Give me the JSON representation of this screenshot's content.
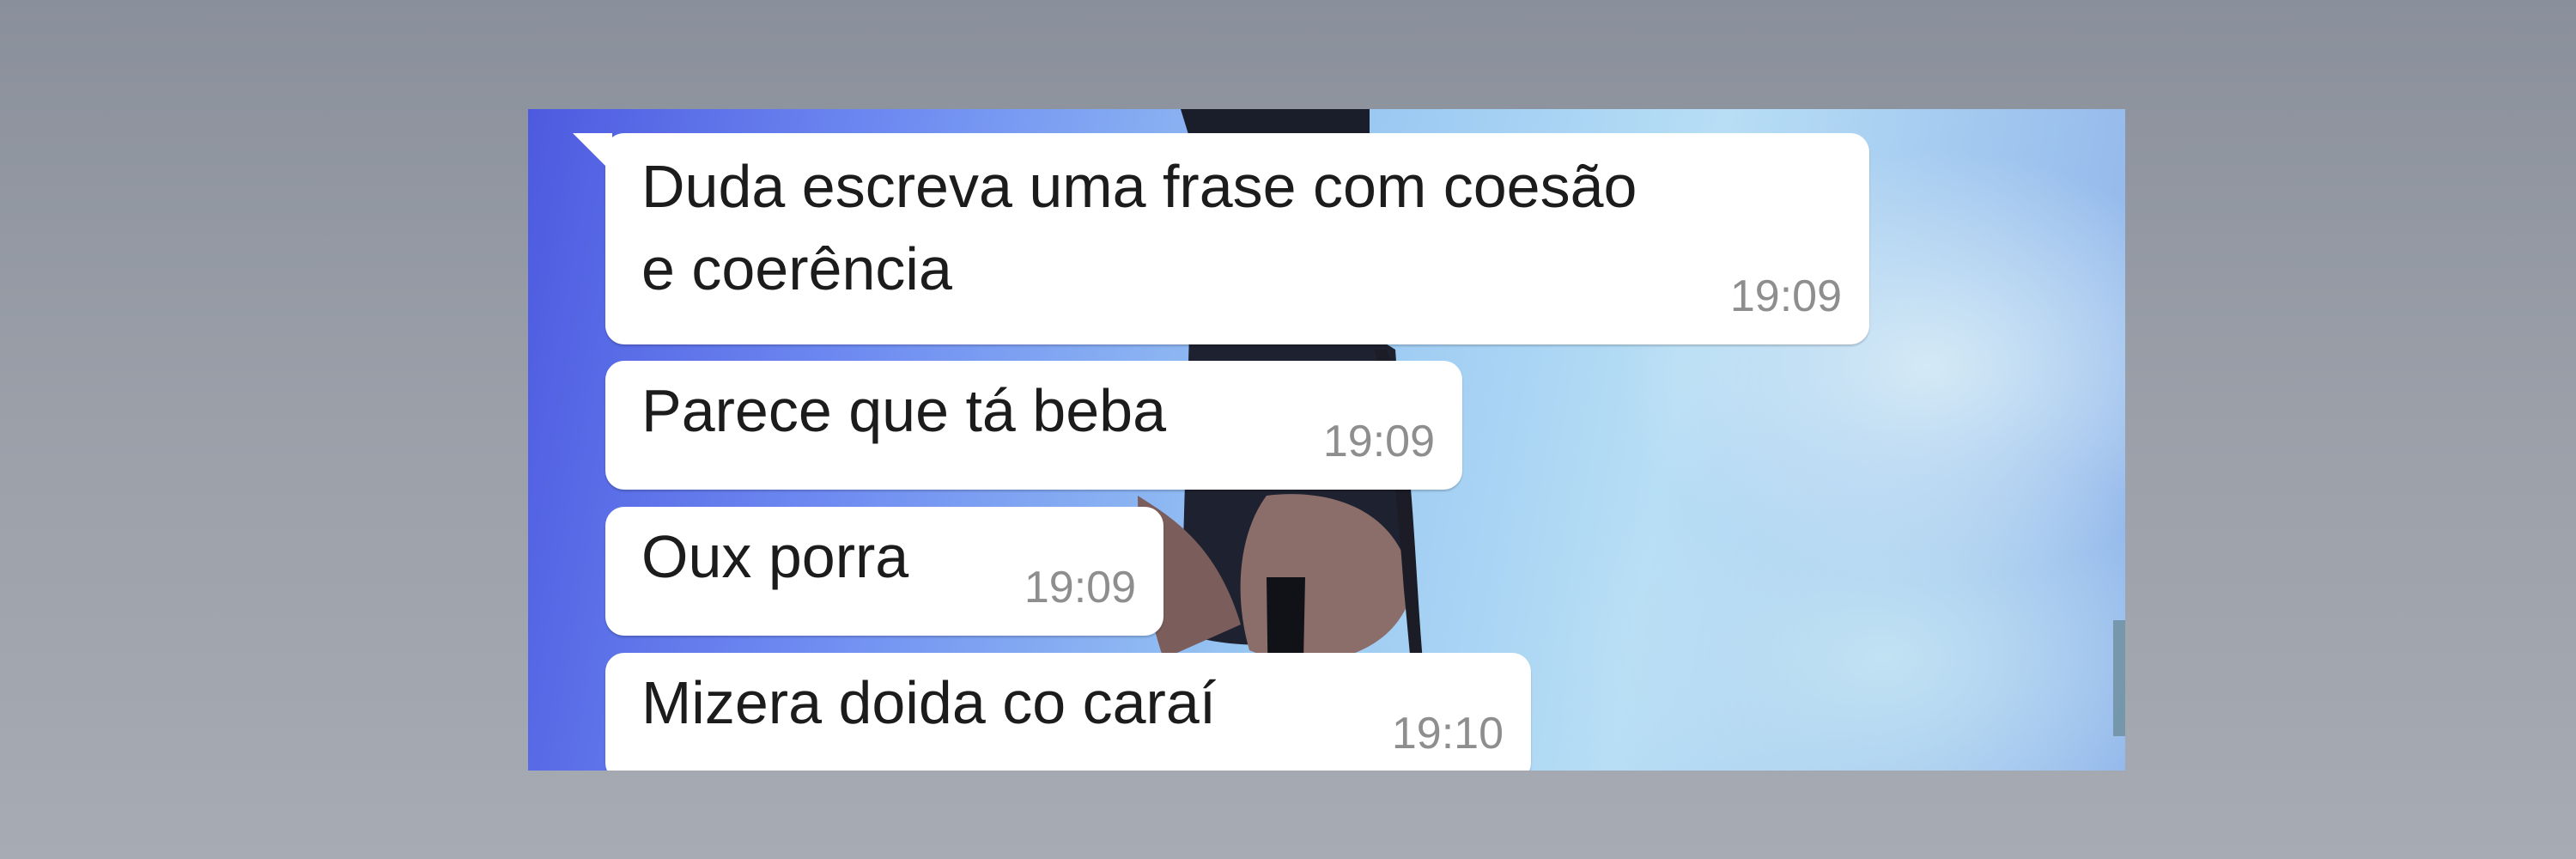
{
  "conversation": {
    "messages": [
      {
        "text_lines": [
          "Duda escreva uma frase com coesão",
          "e coerência"
        ],
        "time": "19:09"
      },
      {
        "text_lines": [
          "Parece que tá beba"
        ],
        "time": "19:09"
      },
      {
        "text_lines": [
          "Oux porra"
        ],
        "time": "19:09"
      },
      {
        "text_lines": [
          "Mizera doida co caraí"
        ],
        "time": "19:10"
      }
    ]
  },
  "colors": {
    "bubble_background": "#ffffff",
    "message_text": "#1c1c1c",
    "timestamp_text": "#8e8e8e"
  }
}
